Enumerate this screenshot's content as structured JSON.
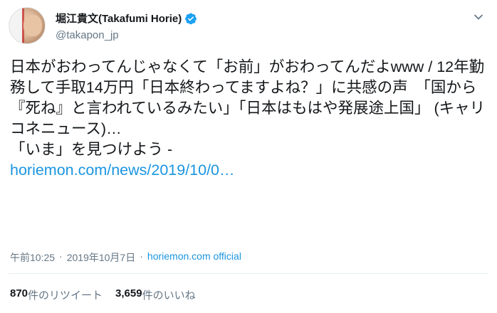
{
  "author": {
    "display_name": "堀江貴文(Takafumi Horie)",
    "handle": "@takapon_jp",
    "verified": true
  },
  "tweet": {
    "text": "日本がおわってんじゃなくて「お前」がおわってんだよwww / 12年勤務して手取14万円「日本終わってますよね？」に共感の声　「国から『死ね』と言われているみたい」「日本はもはや発展途上国」 (キャリコネニュース)…\n「いま」を見つけよう - ",
    "link_text": "horiemon.com/news/2019/10/0…"
  },
  "meta": {
    "time": "午前10:25",
    "date": "2019年10月7日",
    "separator": "·",
    "source": "horiemon.com official"
  },
  "stats": {
    "retweets_count": "870",
    "retweets_label": "件のリツイート",
    "likes_count": "3,659",
    "likes_label": "件のいいね"
  },
  "icons": {
    "verified": "verified-badge-icon",
    "menu": "chevron-down-icon"
  },
  "colors": {
    "link": "#1b95e0",
    "verified": "#1da1f2",
    "secondary_text": "#657786"
  }
}
